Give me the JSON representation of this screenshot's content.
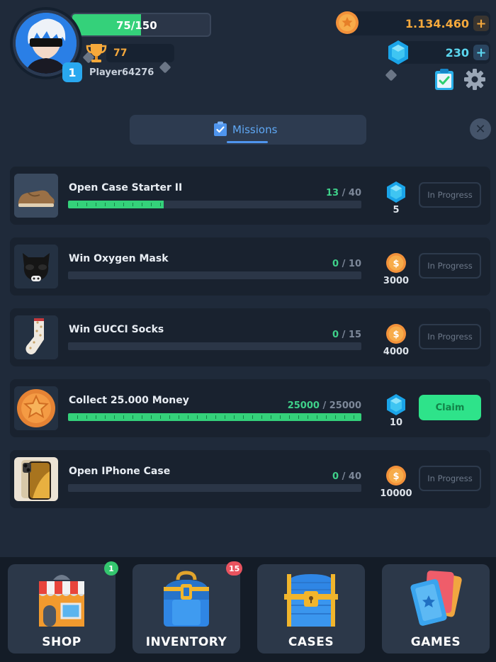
{
  "player": {
    "name": "Player64276",
    "level": "1",
    "xp_current": "75",
    "xp_max": "150",
    "xp_text": "75/150",
    "xp_progress": 0.5,
    "trophies": "77"
  },
  "currency": {
    "coins": "1.134.460",
    "gems": "230",
    "plus": "+"
  },
  "tabs": {
    "missions_label": "Missions",
    "close": "✕"
  },
  "missions": [
    {
      "title": "Open Case Starter II",
      "current": "13",
      "total": "/ 40",
      "progress": 0.325,
      "reward_type": "gem",
      "reward": "5",
      "status": "In Progress",
      "thumb": "sneaker"
    },
    {
      "title": "Win Oxygen Mask",
      "current": "0",
      "total": "/ 10",
      "progress": 0,
      "reward_type": "coin",
      "reward": "3000",
      "status": "In Progress",
      "thumb": "mask"
    },
    {
      "title": "Win GUCCI Socks",
      "current": "0",
      "total": "/ 15",
      "progress": 0,
      "reward_type": "coin",
      "reward": "4000",
      "status": "In Progress",
      "thumb": "sock"
    },
    {
      "title": "Collect 25.000 Money",
      "current": "25000",
      "total": "/ 25000",
      "progress": 1,
      "reward_type": "gem",
      "reward": "10",
      "status": "Claim",
      "thumb": "coin"
    },
    {
      "title": "Open IPhone Case",
      "current": "0",
      "total": "/ 40",
      "progress": 0,
      "reward_type": "coin",
      "reward": "10000",
      "status": "In Progress",
      "thumb": "phone"
    }
  ],
  "nav": [
    {
      "label": "SHOP",
      "badge": "1",
      "badge_color": "#34c66e",
      "icon": "shop-icon"
    },
    {
      "label": "INVENTORY",
      "badge": "15",
      "badge_color": "#e9535f",
      "icon": "backpack-icon"
    },
    {
      "label": "CASES",
      "badge": "",
      "badge_color": "",
      "icon": "chest-icon"
    },
    {
      "label": "GAMES",
      "badge": "",
      "badge_color": "",
      "icon": "cards-icon"
    }
  ],
  "colors": {
    "background": "#1f2a3a",
    "green": "#34d17a",
    "coin": "#f4a83c",
    "gem": "#5bd6ef",
    "accent_blue": "#5fa8f5"
  }
}
